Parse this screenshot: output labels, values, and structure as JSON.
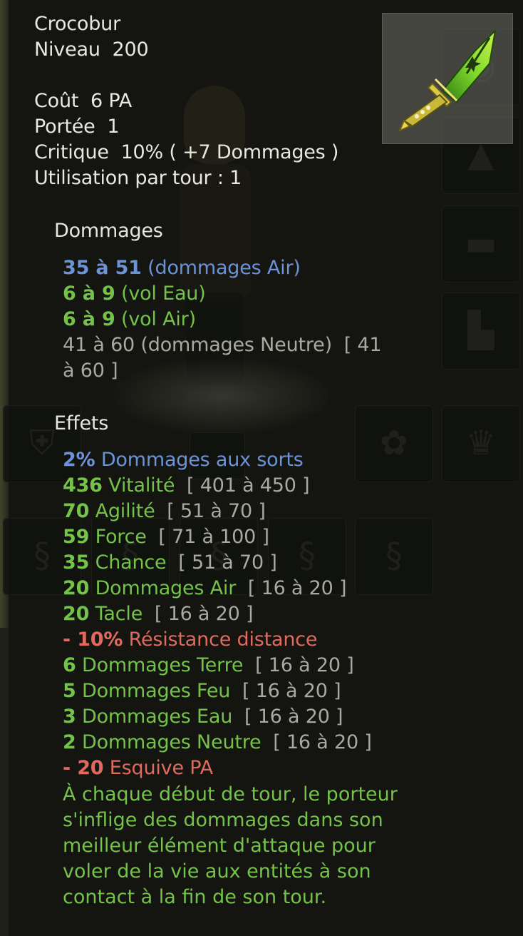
{
  "header": {
    "name": "Crocobur",
    "level_label": "Niveau",
    "level_value": "200",
    "cost_label": "Coût",
    "cost_value": "6 PA",
    "range_label": "Portée",
    "range_value": "1",
    "crit_label": "Critique",
    "crit_value": "10% ( +7 Dommages )",
    "uses_text": "Utilisation par tour : 1"
  },
  "item_icon": "green-dagger-icon",
  "colors": {
    "blue": "#6b93d6",
    "green": "#74c24a",
    "red": "#e06a5f",
    "gray": "#a9a9a0",
    "header": "#e8e8e0"
  },
  "damages": {
    "title": "Dommages",
    "lines": [
      {
        "value": "35 à 51",
        "label": "(dommages Air)"
      },
      {
        "value": "6 à 9",
        "label": "(vol Eau)"
      },
      {
        "value": "6 à 9",
        "label": "(vol Air)"
      },
      {
        "value": "41 à 60",
        "label": "(dommages Neutre)",
        "range_line1": "[ 41",
        "range_line2": "à 60 ]"
      }
    ]
  },
  "effects": {
    "title": "Effets",
    "lines": [
      {
        "value": "2%",
        "label": "Dommages aux sorts",
        "range": ""
      },
      {
        "value": "436",
        "label": "Vitalité",
        "range": "[ 401 à 450 ]"
      },
      {
        "value": "70",
        "label": "Agilité",
        "range": "[ 51 à 70 ]"
      },
      {
        "value": "59",
        "label": "Force",
        "range": "[ 71 à 100 ]"
      },
      {
        "value": "35",
        "label": "Chance",
        "range": "[ 51 à 70 ]"
      },
      {
        "value": "20",
        "label": "Dommages Air",
        "range": "[ 16 à 20 ]"
      },
      {
        "value": "20",
        "label": "Tacle",
        "range": "[ 16 à 20 ]"
      },
      {
        "value": "- 10%",
        "label": "Résistance distance",
        "range": ""
      },
      {
        "value": "6",
        "label": "Dommages Terre",
        "range": "[ 16 à 20 ]"
      },
      {
        "value": "5",
        "label": "Dommages Feu",
        "range": "[ 16 à 20 ]"
      },
      {
        "value": "3",
        "label": "Dommages Eau",
        "range": "[ 16 à 20 ]"
      },
      {
        "value": "2",
        "label": "Dommages Neutre",
        "range": "[ 16 à 20 ]"
      },
      {
        "value": "- 20",
        "label": "Esquive PA",
        "range": ""
      }
    ],
    "description": "À chaque début de tour, le porteur s'inflige des dommages dans son meilleur élément d'attaque pour voler de la vie aux entités à son contact à la fin de son tour."
  }
}
